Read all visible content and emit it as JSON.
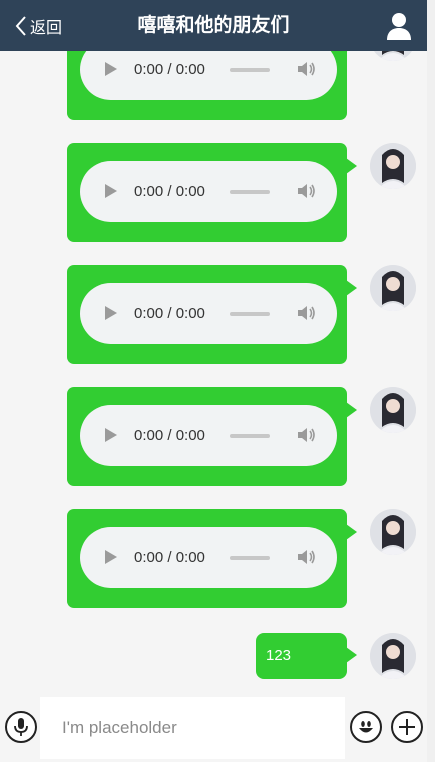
{
  "header": {
    "back_label": "返回",
    "title": "嘻嘻和他的朋友们"
  },
  "messages": [
    {
      "type": "audio",
      "time": "0:00 / 0:00"
    },
    {
      "type": "audio",
      "time": "0:00 / 0:00"
    },
    {
      "type": "audio",
      "time": "0:00 / 0:00"
    },
    {
      "type": "audio",
      "time": "0:00 / 0:00"
    },
    {
      "type": "audio",
      "time": "0:00 / 0:00"
    },
    {
      "type": "text",
      "text": "123"
    }
  ],
  "input": {
    "placeholder": "I'm placeholder",
    "value": ""
  },
  "icons": {
    "back": "chevron-left-icon",
    "user": "user-icon",
    "play": "play-icon",
    "volume": "volume-icon",
    "mic": "microphone-icon",
    "emoji": "smiley-icon",
    "plus": "plus-icon"
  },
  "colors": {
    "header": "#2f4358",
    "bubble": "#32cd32",
    "background": "#f5f5f5",
    "audio_player": "#f1f3f4"
  }
}
